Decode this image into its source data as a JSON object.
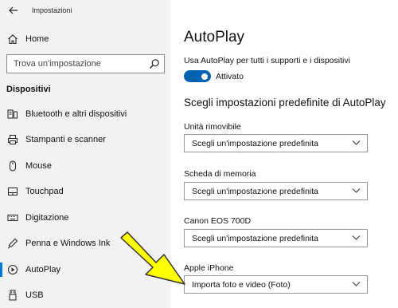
{
  "app": {
    "title": "Impostazioni"
  },
  "sidebar": {
    "home_label": "Home",
    "search_placeholder": "Trova un'impostazione",
    "section_title": "Dispositivi",
    "items": [
      {
        "label": "Bluetooth e altri dispositivi",
        "icon": "bluetooth-devices-icon"
      },
      {
        "label": "Stampanti e scanner",
        "icon": "printer-icon"
      },
      {
        "label": "Mouse",
        "icon": "mouse-icon"
      },
      {
        "label": "Touchpad",
        "icon": "touchpad-icon"
      },
      {
        "label": "Digitazione",
        "icon": "keyboard-icon"
      },
      {
        "label": "Penna e Windows Ink",
        "icon": "pen-icon"
      },
      {
        "label": "AutoPlay",
        "icon": "autoplay-icon",
        "active": true
      },
      {
        "label": "USB",
        "icon": "usb-icon"
      }
    ]
  },
  "main": {
    "title": "AutoPlay",
    "toggle_description": "Usa AutoPlay per tutti i supporti e i dispositivi",
    "toggle_state": "Attivato",
    "toggle_on": true,
    "subtitle": "Scegli impostazioni predefinite di AutoPlay",
    "fields": [
      {
        "label": "Unità rimovibile",
        "value": "Scegli un'impostazione predefinita"
      },
      {
        "label": "Scheda di memoria",
        "value": "Scegli un'impostazione predefinita"
      },
      {
        "label": "Canon EOS 700D",
        "value": "Scegli un'impostazione predefinita"
      },
      {
        "label": "Apple iPhone",
        "value": "Importa foto e video (Foto)"
      }
    ]
  },
  "colors": {
    "accent": "#0078d7",
    "toggle": "#0063b1",
    "sidebar_bg": "#f2f2f2",
    "arrow_fill": "#ffff00"
  }
}
